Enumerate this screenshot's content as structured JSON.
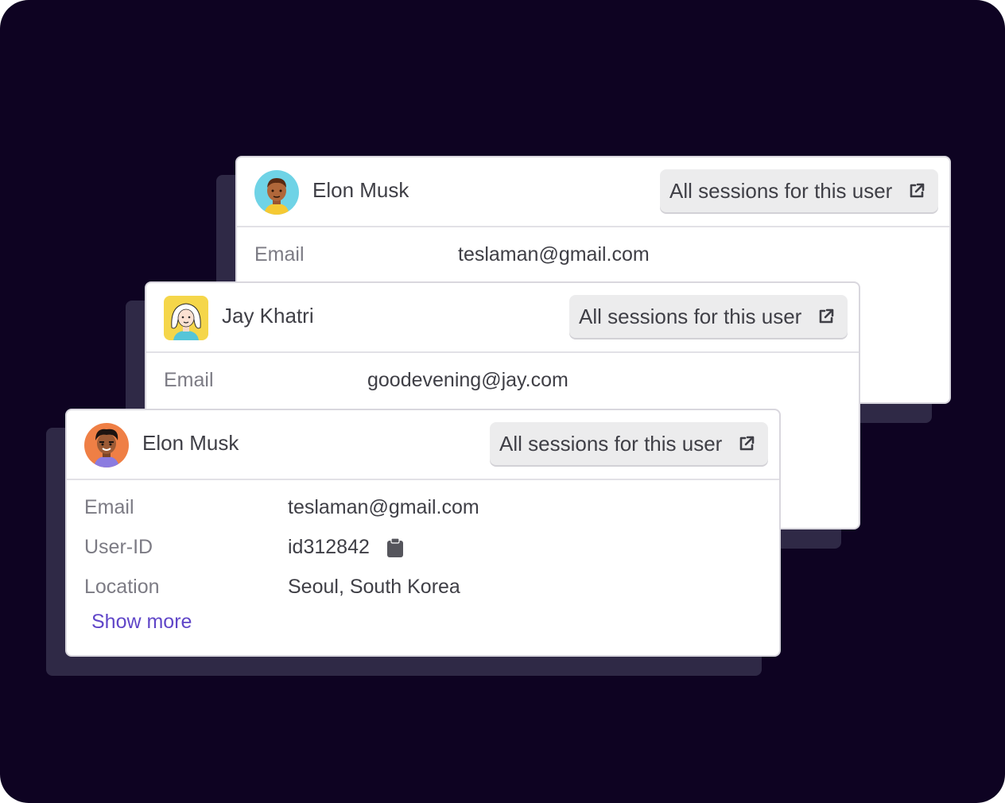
{
  "colors": {
    "background": "#0e0322",
    "card": "#ffffff",
    "stack_shadow": "#2f2946",
    "button_bg": "#ececed",
    "link": "#6046c8",
    "label_gray": "#7c7b84",
    "value_text": "#3f3f46"
  },
  "cards": [
    {
      "name": "Elon Musk",
      "avatar_icon": "avatar-cyan-icon",
      "sessions_button": "All sessions for this user",
      "fields": [
        {
          "label": "Email",
          "value": "teslaman@gmail.com"
        }
      ]
    },
    {
      "name": "Jay Khatri",
      "avatar_icon": "avatar-yellow-icon",
      "sessions_button": "All sessions for this user",
      "fields": [
        {
          "label": "Email",
          "value": "goodevening@jay.com"
        }
      ]
    },
    {
      "name": "Elon Musk",
      "avatar_icon": "avatar-orange-icon",
      "sessions_button": "All sessions for this user",
      "fields": [
        {
          "label": "Email",
          "value": "teslaman@gmail.com"
        },
        {
          "label": "User-ID",
          "value": "id312842"
        },
        {
          "label": "Location",
          "value": "Seoul, South Korea"
        }
      ],
      "show_more": "Show more"
    }
  ]
}
